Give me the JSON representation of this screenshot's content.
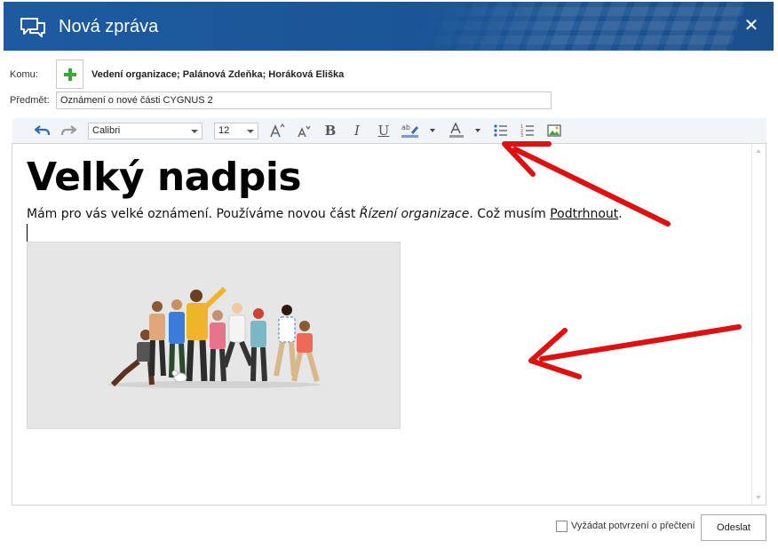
{
  "window": {
    "title": "Nová zpráva",
    "close_glyph": "✕",
    "icon": "chat-bubbles-icon",
    "accent_color": "#1d5aa0"
  },
  "form": {
    "to_label": "Komu:",
    "recipients": "Vedení organizace; Palánová Zdeňka; Horáková Eliška",
    "subject_label": "Předmět:",
    "subject_value": "Oznámení o nové části CYGNUS 2"
  },
  "toolbar": {
    "font_family": "Calibri",
    "font_size": "12",
    "bold": "B",
    "italic": "I",
    "underline": "U",
    "items": [
      "undo-icon",
      "redo-icon",
      "grow-font-icon",
      "shrink-font-icon",
      "highlight-icon",
      "font-color-icon",
      "bullet-list-icon",
      "numbered-list-icon",
      "insert-image-icon"
    ]
  },
  "editor": {
    "heading": "Velký nadpis",
    "para_start": "Mám pro vás velké oznámení. Používáme novou část ",
    "para_italic": "Řízení organizace",
    "para_middle": ". Což musím ",
    "para_underline": "Podtrhnout",
    "para_end": "."
  },
  "footer": {
    "read_receipt_label": "Vyžádat potvrzení o přečtení",
    "read_receipt_checked": false,
    "send_label": "Odeslat"
  }
}
